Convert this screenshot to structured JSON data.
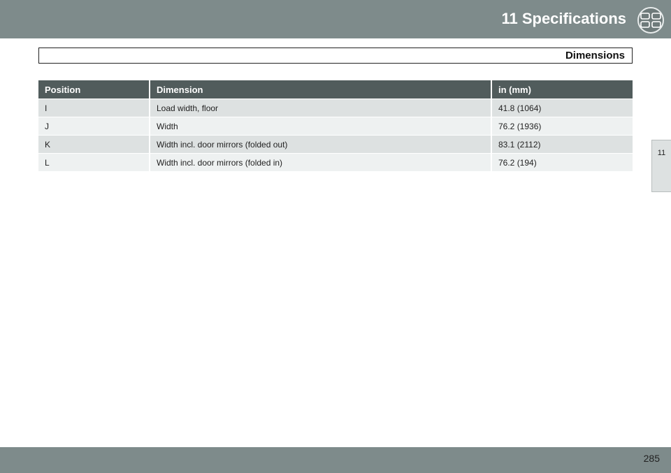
{
  "header": {
    "chapter_title": "11 Specifications",
    "chapter_icon": "spec-badge-icon",
    "band_color": "#7e8b8b"
  },
  "section": {
    "title": "Dimensions"
  },
  "side_tab": {
    "label": "11"
  },
  "table": {
    "header_color": "#515c5c",
    "columns": [
      "Position",
      "Dimension",
      "in (mm)"
    ],
    "rows": [
      [
        "I",
        "Load width, floor",
        "41.8 (1064)"
      ],
      [
        "J",
        "Width",
        "76.2 (1936)"
      ],
      [
        "K",
        "Width incl. door mirrors (folded out)",
        "83.1 (2112)"
      ],
      [
        "L",
        "Width incl. door mirrors (folded in)",
        "76.2 (194)"
      ]
    ]
  },
  "footer": {
    "page_number": "285"
  }
}
